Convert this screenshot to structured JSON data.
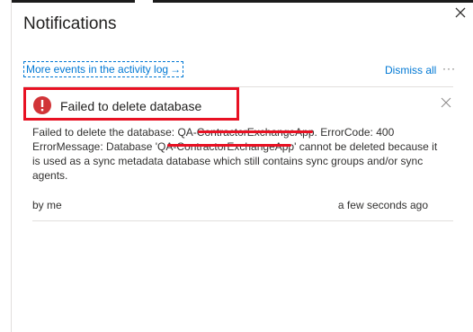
{
  "panel": {
    "title": "Notifications",
    "close_icon": "close-icon"
  },
  "toolbar": {
    "more_events_label": "More events in the activity log",
    "more_events_arrow": "→",
    "dismiss_all_label": "Dismiss all",
    "more_options_label": "···"
  },
  "notification": {
    "status_icon": "error-icon",
    "status_color": "#d13438",
    "highlight_color": "#e81123",
    "title": "Failed to delete database",
    "message": "Failed to delete the database: QA-ContractorExchangeApp. ErrorCode: 400 ErrorMessage: Database 'QA-ContractorExchangeApp' cannot be deleted because it is used as a sync metadata database which still contains sync groups and/or sync agents.",
    "by": "by me",
    "time": "a few seconds ago"
  },
  "colors": {
    "accent": "#0078d4",
    "text": "#323130"
  }
}
